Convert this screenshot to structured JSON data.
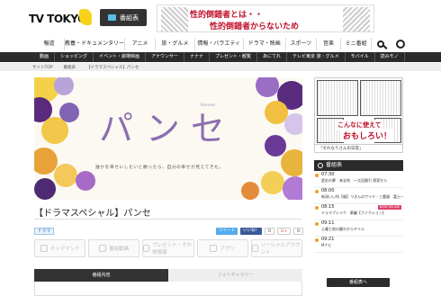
{
  "header": {
    "logo_text": "TV TOKYO",
    "guide_button": "番組表",
    "banner_line1": "性的倒錯者とは・・",
    "banner_line2": "性的倒錯者からないため"
  },
  "main_nav": [
    "報道",
    "教養・ドキュメンタリー",
    "アニメ",
    "旅・グルメ",
    "情報・バラエティ",
    "ドラマ・映画",
    "スポーツ",
    "音楽",
    "ミニ番組"
  ],
  "sub_nav": [
    "動画",
    "ショッピング",
    "イベント・劇場映画",
    "アナウンサー",
    "ナナナ",
    "プレゼント・観覧",
    "あにてれ",
    "テレビ東京 旅・グルメ",
    "モバイル",
    "読みモノ"
  ],
  "breadcrumb": [
    "サイトTOP",
    "番組表",
    "【ドラマスペシャル】パンセ"
  ],
  "hero": {
    "title": "パンセ",
    "title_small": "Pensees",
    "caption": "誰かを幸せにしたいと願ったら、自分の幸せが見えてきた。"
  },
  "page_title": "【ドラマスペシャル】パンセ",
  "genre_tag": "ドラマ",
  "social": {
    "tweet": "ツイート",
    "like": "いいね！",
    "like_count": "0",
    "gplus": "G+",
    "gplus_count": "0"
  },
  "actions": [
    "オンデマンド",
    "番組動画",
    "プレゼント・その他情報",
    "アプリ",
    "ソーシャルアカウント"
  ],
  "tabs": {
    "active": "番組内容",
    "inactive": "フォトギャラリー"
  },
  "sidebar": {
    "ad_line1": "こんなに使えて",
    "ad_line2": "おもしろい！",
    "ad_footer": "「それなりさんの日常」",
    "schedule_title": "番組表",
    "schedule": [
      {
        "time": "07:30",
        "program": "歴史の夢　来支地　～太田國引 探索から",
        "program2": "見渡すの岐を目読む",
        "onair": ""
      },
      {
        "time": "08:00",
        "program": "新潟いい所【福】つきんのワイド・三重福　富士一望",
        "program2": "",
        "onair": ""
      },
      {
        "time": "08:15",
        "program": "ドラマブレイク　華麗【ファクション】",
        "program2": "",
        "onair": "NOW ON AIR"
      },
      {
        "time": "09:11",
        "program": "土曜と他の鍵わからヤイル",
        "program2": "",
        "onair": ""
      },
      {
        "time": "09:21",
        "program": "Mナビ",
        "program2": "",
        "onair": ""
      }
    ],
    "schedule_more": "番組表へ"
  }
}
